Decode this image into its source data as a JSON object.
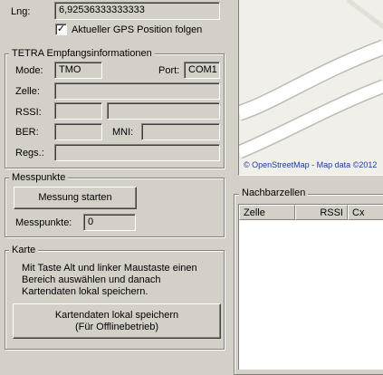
{
  "gps": {
    "lng_label": "Lng:",
    "lng_value": "6,92536333333333",
    "follow_checkbox_label": "Aktueller GPS Position folgen",
    "follow_checked": true
  },
  "tetra": {
    "group_title": "TETRA Empfangsinformationen",
    "mode_label": "Mode:",
    "mode_value": "TMO",
    "port_label": "Port:",
    "port_value": "COM1",
    "zelle_label": "Zelle:",
    "zelle_value": "",
    "rssi_label": "RSSI:",
    "rssi_value": "",
    "rssi_extra_value": "",
    "ber_label": "BER:",
    "ber_value": "",
    "mni_label": "MNI:",
    "mni_value": "",
    "regs_label": "Regs.:",
    "regs_value": ""
  },
  "messpunkte": {
    "group_title": "Messpunkte",
    "start_button_label": "Messung starten",
    "count_label": "Messpunkte:",
    "count_value": "0"
  },
  "karte": {
    "group_title": "Karte",
    "instructions": "Mit Taste Alt und linker Maustaste einen Bereich auswählen und danach Kartendaten lokal speichern.",
    "save_button_line1": "Kartendaten lokal speichern",
    "save_button_line2": "(Für Offlinebetrieb)"
  },
  "map": {
    "attribution": "© OpenStreetMap - Map data ©2012"
  },
  "nachbarzellen": {
    "group_title": "Nachbarzellen",
    "columns": [
      "Zelle",
      "RSSI",
      "Cx"
    ],
    "rows": []
  }
}
